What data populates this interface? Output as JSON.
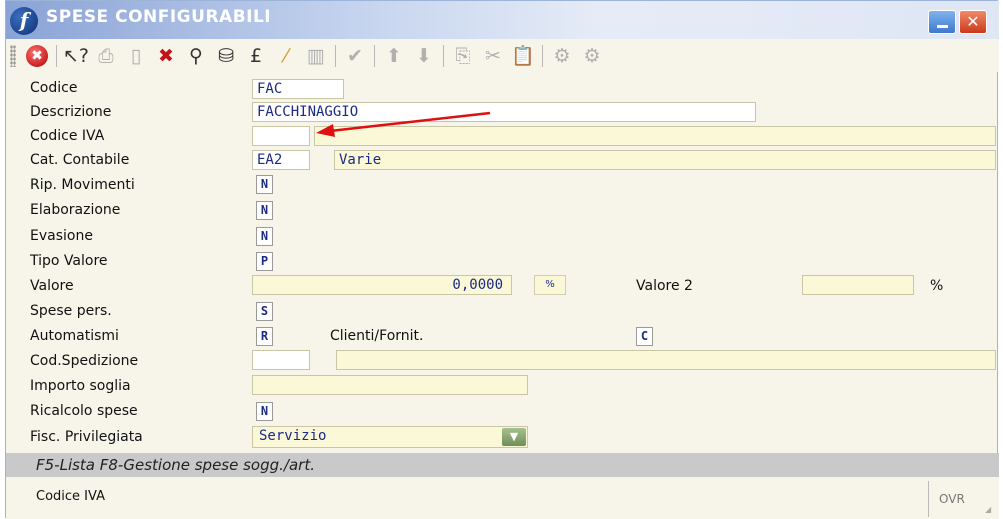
{
  "window": {
    "title": "SPESE CONFIGURABILI",
    "logo_letter": "f",
    "close_glyph": "✕"
  },
  "toolbar": {
    "icons": [
      "grip-icon",
      "stop-icon",
      "separator",
      "help-pointer-icon",
      "print-icon",
      "new-document-icon",
      "delete-icon",
      "search-icon",
      "binoculars-icon",
      "currency-icon",
      "magic-wand-icon",
      "columns-icon",
      "separator",
      "check-icon",
      "separator",
      "arrow-up-icon",
      "arrow-down-icon",
      "separator",
      "copy-icon",
      "cut-icon",
      "paste-icon",
      "separator",
      "gears-icon",
      "gears-alt-icon"
    ]
  },
  "form": {
    "codice": {
      "label": "Codice",
      "value": "FAC"
    },
    "descrizione": {
      "label": "Descrizione",
      "value": "FACCHINAGGIO"
    },
    "codice_iva": {
      "label": "Codice IVA",
      "value": "",
      "desc": ""
    },
    "cat_contabile": {
      "label": "Cat. Contabile",
      "value": "EA2",
      "desc": "Varie"
    },
    "rip_movimenti": {
      "label": "Rip. Movimenti",
      "value": "N"
    },
    "elaborazione": {
      "label": "Elaborazione",
      "value": "N"
    },
    "evasione": {
      "label": "Evasione",
      "value": "N"
    },
    "tipo_valore": {
      "label": "Tipo Valore",
      "value": "P"
    },
    "valore": {
      "label": "Valore",
      "value": "0,0000",
      "unit": "%"
    },
    "valore2": {
      "label": "Valore 2",
      "value": "",
      "unit": "%"
    },
    "spese_pers": {
      "label": "Spese pers.",
      "value": "S"
    },
    "automatismi": {
      "label": "Automatismi",
      "value": "R"
    },
    "clienti_fornit": {
      "label": "Clienti/Fornit.",
      "value": "C"
    },
    "cod_spedizione": {
      "label": "Cod.Spedizione",
      "value": "",
      "desc": ""
    },
    "importo_soglia": {
      "label": "Importo soglia",
      "value": ""
    },
    "ricalcolo_spese": {
      "label": "Ricalcolo spese",
      "value": "N"
    },
    "fisc_privilegiata": {
      "label": "Fisc. Privilegiata",
      "value": "Servizio"
    }
  },
  "status": {
    "hint": "F5-Lista F8-Gestione spese sogg./art.",
    "field_help": "Codice IVA",
    "mode": "OVR"
  },
  "colors": {
    "field_bg": "#fbf8d8",
    "field_text": "#1a2a86",
    "annotation_arrow": "#e01010"
  }
}
